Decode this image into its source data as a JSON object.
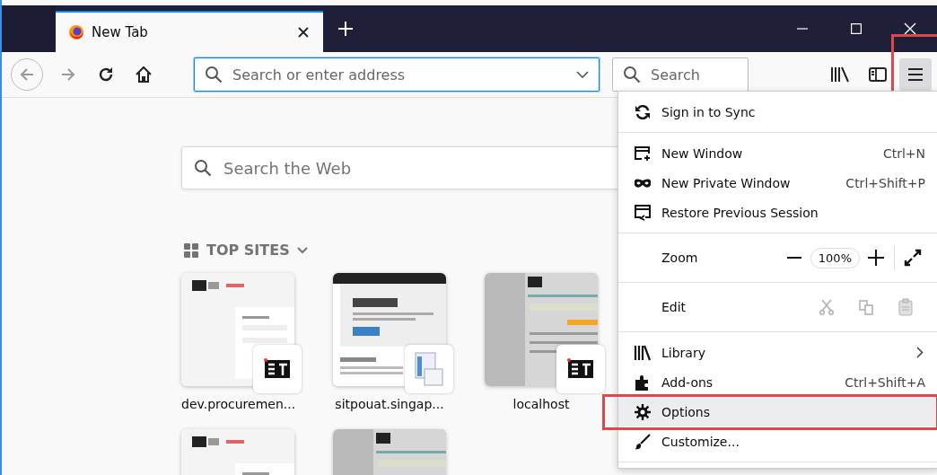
{
  "tab": {
    "title": "New Tab",
    "selected": true
  },
  "toolbar": {
    "address_placeholder": "Search or enter address",
    "search_placeholder": "Search",
    "menu_button": {
      "open": true,
      "highlighted": true
    }
  },
  "newtab": {
    "search_placeholder": "Search the Web",
    "section_title": "TOP SITES",
    "tiles": [
      {
        "label": "dev.procuremen...",
        "kind": "login"
      },
      {
        "label": "sitpouat.singap...",
        "kind": "aspnet"
      },
      {
        "label": "localhost",
        "kind": "form"
      },
      {
        "kind": "login"
      },
      {
        "kind": "form"
      }
    ]
  },
  "menu": {
    "items": [
      {
        "kind": "item",
        "label": "Sign in to Sync",
        "selected": false,
        "highlighted": false
      },
      {
        "kind": "separator"
      },
      {
        "kind": "item",
        "label": "New Window",
        "shortcut": "Ctrl+N",
        "selected": false,
        "highlighted": false
      },
      {
        "kind": "item",
        "label": "New Private Window",
        "shortcut": "Ctrl+Shift+P",
        "selected": false,
        "highlighted": false
      },
      {
        "kind": "item",
        "label": "Restore Previous Session",
        "selected": false,
        "highlighted": false
      },
      {
        "kind": "separator"
      },
      {
        "kind": "zoom",
        "label": "Zoom",
        "value": "100%"
      },
      {
        "kind": "separator"
      },
      {
        "kind": "edit",
        "label": "Edit",
        "disabled": true
      },
      {
        "kind": "separator"
      },
      {
        "kind": "item",
        "label": "Library",
        "submenu": true,
        "selected": false,
        "highlighted": false
      },
      {
        "kind": "item",
        "label": "Add-ons",
        "shortcut": "Ctrl+Shift+A",
        "selected": false,
        "highlighted": false
      },
      {
        "kind": "item",
        "label": "Options",
        "selected": true,
        "highlighted": true
      },
      {
        "kind": "item",
        "label": "Customize...",
        "selected": false,
        "highlighted": false
      },
      {
        "kind": "separator"
      }
    ]
  }
}
